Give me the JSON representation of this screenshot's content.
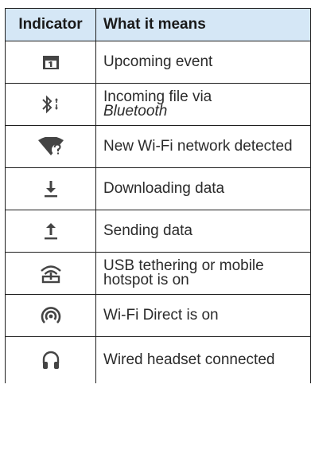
{
  "header": {
    "indicator_label": "Indicator",
    "meaning_label": "What it means"
  },
  "rows": [
    {
      "icon": "calendar-icon",
      "text": "Upcoming event"
    },
    {
      "icon": "bluetooth-transfer-icon",
      "text_prefix": "Incoming file via",
      "text_italic": "Bluetooth"
    },
    {
      "icon": "wifi-question-icon",
      "text": "New Wi-Fi network detected"
    },
    {
      "icon": "download-icon",
      "text": "Downloading data"
    },
    {
      "icon": "upload-icon",
      "text": "Sending data"
    },
    {
      "icon": "usb-hotspot-icon",
      "text": "USB tethering or mobile hotspot is on"
    },
    {
      "icon": "wifi-direct-icon",
      "text": "Wi-Fi Direct is on"
    },
    {
      "icon": "headset-icon",
      "text": "Wired headset connected"
    }
  ],
  "colors": {
    "header_bg": "#d5e7f6",
    "icon_color": "#444444",
    "border": "#1f1f1f"
  }
}
